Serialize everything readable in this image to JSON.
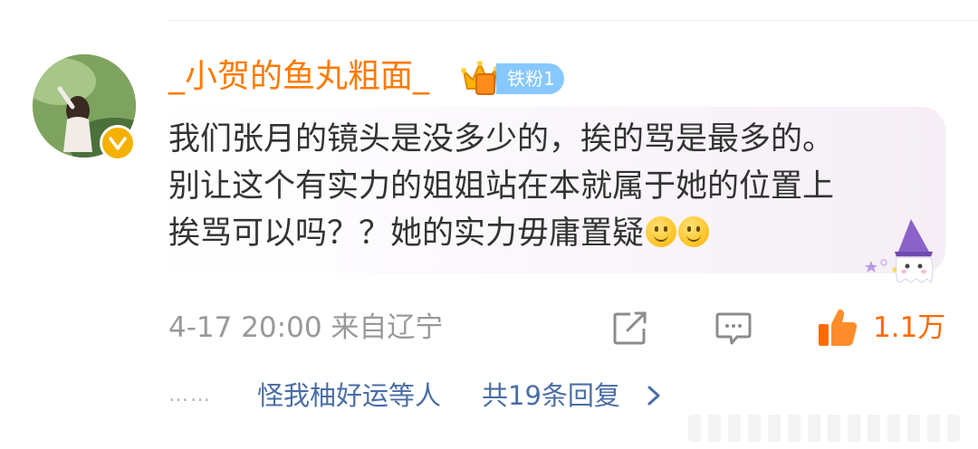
{
  "comment": {
    "username": "_小贺的鱼丸粗面_",
    "fan_badge": "铁粉1",
    "text_lines": [
      "我们张月的镜头是没多少的，挨的骂是最多的。",
      "别让这个有实力的姐姐站在本就属于她的位置上",
      "挨骂可以吗？？她的实力毋庸置疑"
    ],
    "meta": "4-17 20:00  来自辽宁",
    "like_count": "1.1万"
  },
  "replies": {
    "dots": "……",
    "user": "怪我柚好运等人",
    "count_text": "共19条回复"
  },
  "colors": {
    "username": "#ff7a00",
    "link": "#4a6ea6",
    "like": "#ff6a00",
    "meta": "#999999"
  },
  "icons": [
    "avatar",
    "verified-badge-icon",
    "crown-badge-icon",
    "ghost-sticker-icon",
    "share-icon",
    "comment-icon",
    "like-icon",
    "chevron-right-icon",
    "smile-emoji-icon"
  ]
}
